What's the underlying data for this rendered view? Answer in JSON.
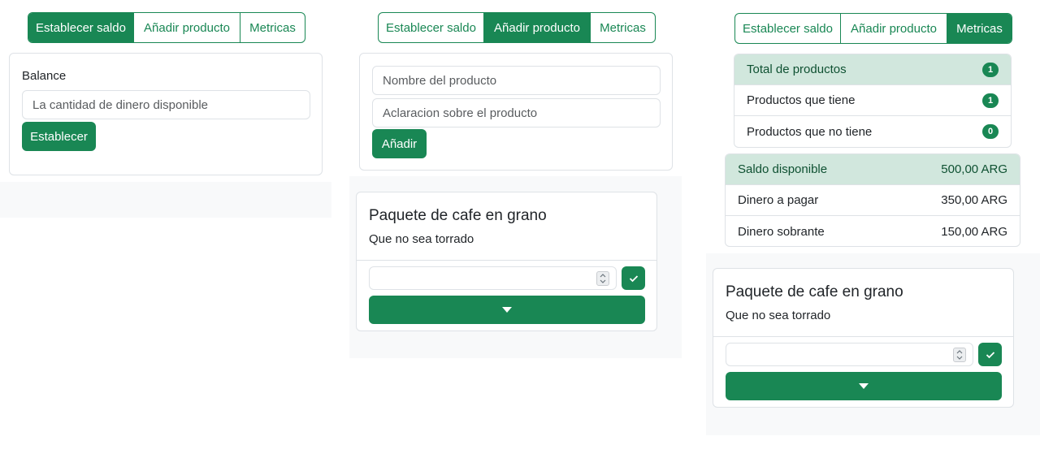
{
  "tabs": {
    "balance": "Establecer saldo",
    "add_product": "Añadir producto",
    "metrics": "Metricas"
  },
  "balance_panel": {
    "label": "Balance",
    "placeholder": "La cantidad de dinero disponible",
    "button": "Establecer"
  },
  "add_panel": {
    "name_placeholder": "Nombre del producto",
    "desc_placeholder": "Aclaracion sobre el producto",
    "button": "Añadir"
  },
  "product": {
    "title": "Paquete de cafe en grano",
    "subtitle": "Que no sea torrado"
  },
  "metrics": {
    "counts": [
      {
        "label": "Total de productos",
        "value": "1"
      },
      {
        "label": "Productos que tiene",
        "value": "1"
      },
      {
        "label": "Productos que no tiene",
        "value": "0"
      }
    ],
    "money": [
      {
        "label": "Saldo disponible",
        "value": "500,00 ARG"
      },
      {
        "label": "Dinero a pagar",
        "value": "350,00 ARG"
      },
      {
        "label": "Dinero sobrante",
        "value": "150,00 ARG"
      }
    ]
  },
  "colors": {
    "accent": "#198754",
    "highlight": "#d1e7dd"
  }
}
